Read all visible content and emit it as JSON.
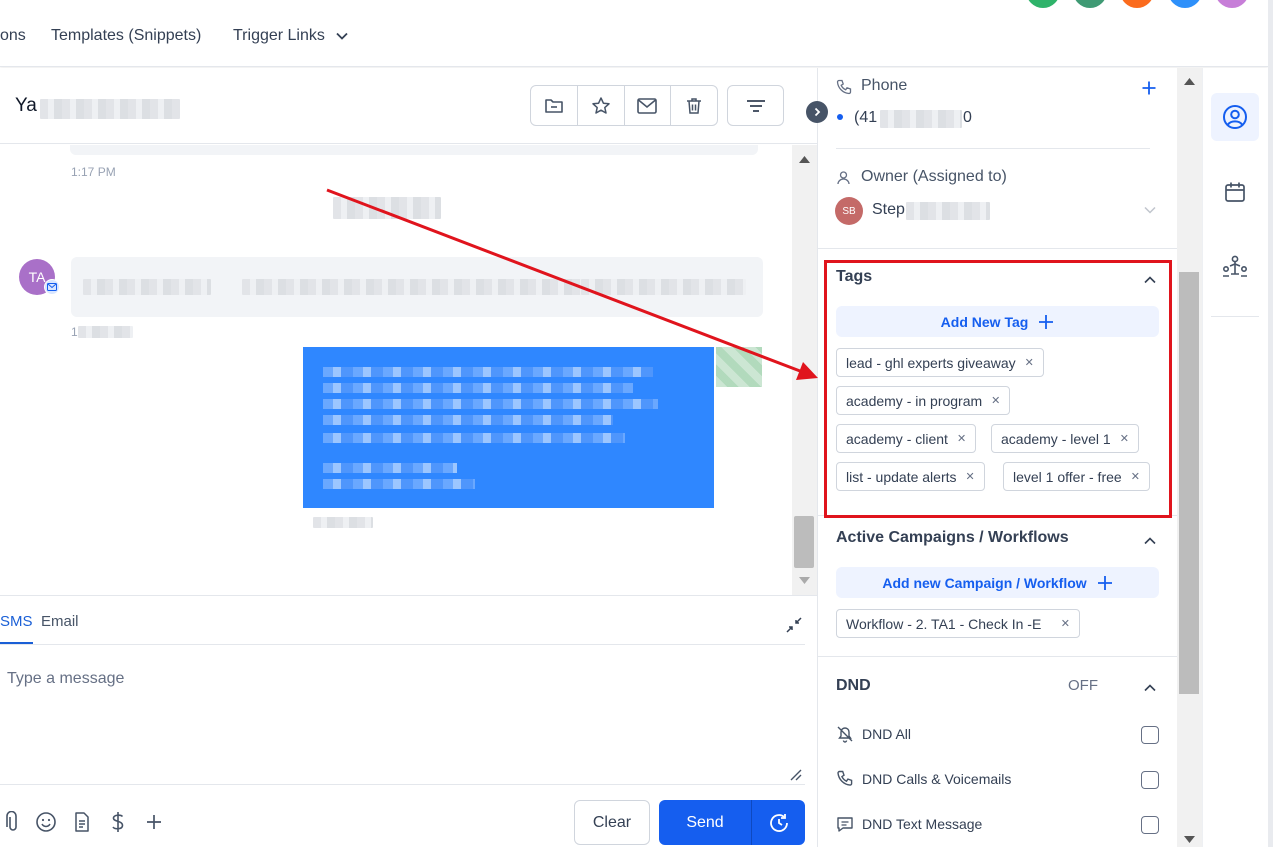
{
  "topnav": {
    "items": [
      "ons",
      "Templates (Snippets)",
      "Trigger Links"
    ],
    "avatar_colors": [
      "#2fb36a",
      "#3f9a74",
      "#fb6b1d",
      "#2e90fa",
      "#c77ed8"
    ]
  },
  "conversation": {
    "contact_name": "Ya",
    "toolbar_icons": [
      "folder-icon",
      "star-icon",
      "mail-icon",
      "trash-icon"
    ],
    "filter_icon": "filter-lines-icon"
  },
  "messages": {
    "top_timestamp": "1:17 PM",
    "incoming_avatar_initials": "TA",
    "incoming_timestamp_prefix": "1"
  },
  "composer": {
    "tabs": [
      "SMS",
      "Email"
    ],
    "placeholder": "Type a message",
    "clear_label": "Clear",
    "send_label": "Send"
  },
  "contact_panel": {
    "phone_label": "Phone",
    "phone_prefix": "(41",
    "phone_suffix": "0",
    "owner_label": "Owner (Assigned to)",
    "owner_initials": "SB",
    "owner_name_prefix": "Step",
    "tags": {
      "title": "Tags",
      "add_label": "Add New Tag",
      "items": [
        "lead - ghl experts giveaway",
        "academy - in program",
        "academy - client",
        "academy - level 1",
        "list - update alerts",
        "level 1 offer - free"
      ]
    },
    "campaigns": {
      "title": "Active Campaigns / Workflows",
      "add_label": "Add new Campaign / Workflow",
      "items": [
        "Workflow - 2. TA1 - Check In -E"
      ]
    },
    "dnd": {
      "title": "DND",
      "status": "OFF",
      "items": [
        "DND All",
        "DND Calls & Voicemails",
        "DND Text Message"
      ]
    }
  },
  "colors": {
    "accent": "#155eef",
    "highlight": "#e0141d",
    "outgoing_bubble": "#2f87ff"
  }
}
